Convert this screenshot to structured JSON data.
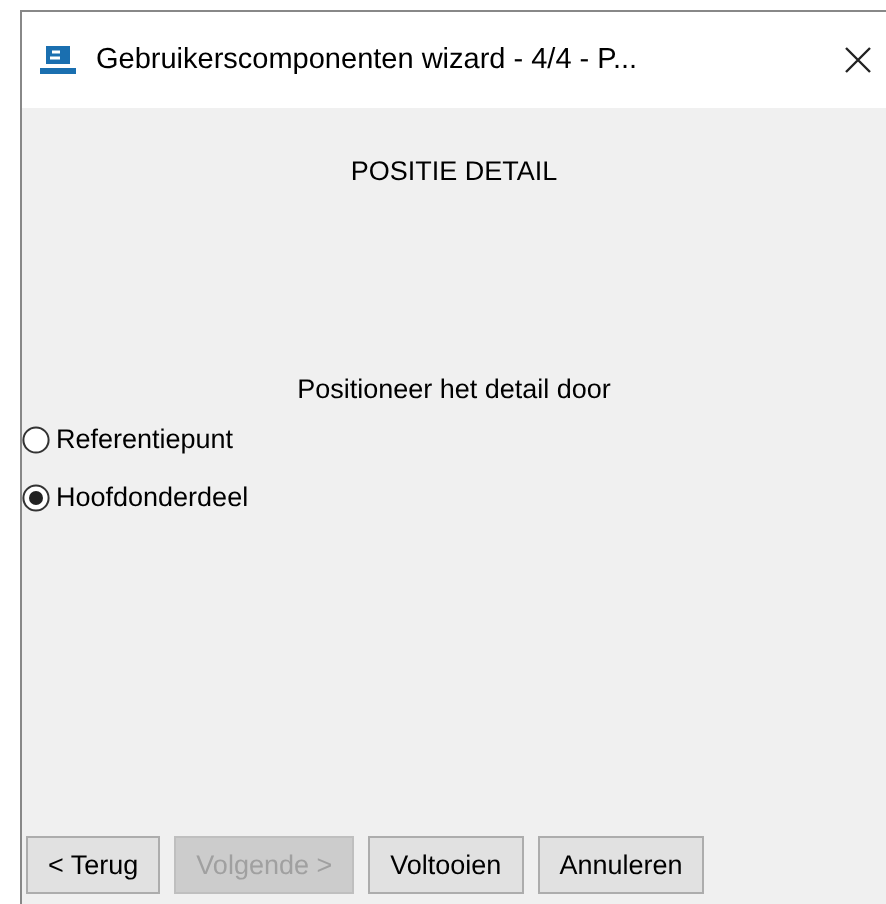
{
  "window": {
    "title": "Gebruikerscomponenten wizard - 4/4 - P..."
  },
  "heading": "POSITIE DETAIL",
  "prompt": "Positioneer het detail door",
  "options": [
    {
      "label": "Referentiepunt",
      "selected": false
    },
    {
      "label": "Hoofdonderdeel",
      "selected": true
    }
  ],
  "buttons": [
    {
      "label": "< Terug",
      "disabled": false
    },
    {
      "label": "Volgende >",
      "disabled": true
    },
    {
      "label": "Voltooien",
      "disabled": false
    },
    {
      "label": "Annuleren",
      "disabled": false
    }
  ]
}
